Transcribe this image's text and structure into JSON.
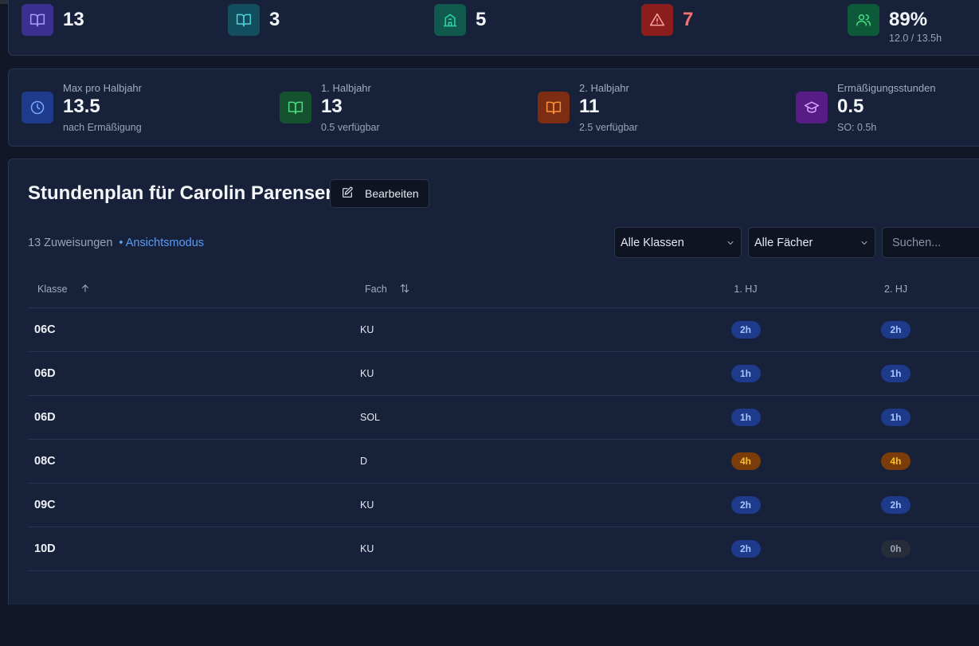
{
  "colors": {
    "background": "#111726",
    "card": "#17213a",
    "accent_blue": "#5b9cf5",
    "warning_red": "#f87171"
  },
  "summary_top": [
    {
      "icon": "book-open-icon",
      "value": "13",
      "sub": ""
    },
    {
      "icon": "book-open-icon",
      "value": "3",
      "sub": ""
    },
    {
      "icon": "school-building-icon",
      "value": "5",
      "sub": ""
    },
    {
      "icon": "alert-triangle-icon",
      "value": "7",
      "sub": ""
    },
    {
      "icon": "users-icon",
      "value": "89%",
      "sub": "12.0 / 13.5h"
    }
  ],
  "summary_bottom": [
    {
      "icon": "clock-icon",
      "label": "Max pro Halbjahr",
      "value": "13.5",
      "sub": "nach Ermäßigung"
    },
    {
      "icon": "book-open-icon",
      "label": "1. Halbjahr",
      "value": "13",
      "sub": "0.5 verfügbar"
    },
    {
      "icon": "book-open-icon",
      "label": "2. Halbjahr",
      "value": "11",
      "sub": "2.5 verfügbar"
    },
    {
      "icon": "graduation-cap-icon",
      "label": "Ermäßigungsstunden",
      "value": "0.5",
      "sub": "SO: 0.5h"
    }
  ],
  "schedule": {
    "title": "Stundenplan für Carolin Parensen",
    "edit_label": "Bearbeiten",
    "count_text": "13 Zuweisungen",
    "mode_text": "• Ansichtsmodus",
    "filter_classes": "Alle Klassen",
    "filter_subjects": "Alle Fächer",
    "search_placeholder": "Suchen...",
    "columns": {
      "klasse": "Klasse",
      "fach": "Fach",
      "hj1": "1. HJ",
      "hj2": "2. HJ"
    },
    "rows": [
      {
        "klasse": "06C",
        "fach": "KU",
        "hj1": "2h",
        "hj2": "2h"
      },
      {
        "klasse": "06D",
        "fach": "KU",
        "hj1": "1h",
        "hj2": "1h"
      },
      {
        "klasse": "06D",
        "fach": "SOL",
        "hj1": "1h",
        "hj2": "1h"
      },
      {
        "klasse": "08C",
        "fach": "D",
        "hj1": "4h",
        "hj2": "4h"
      },
      {
        "klasse": "09C",
        "fach": "KU",
        "hj1": "2h",
        "hj2": "2h"
      },
      {
        "klasse": "10D",
        "fach": "KU",
        "hj1": "2h",
        "hj2": "0h"
      }
    ]
  }
}
